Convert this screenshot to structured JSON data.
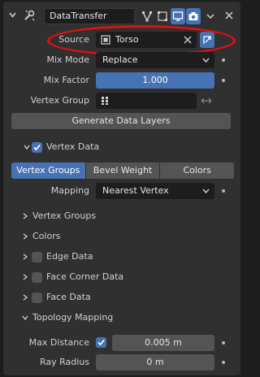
{
  "header": {
    "modifier_name": "DataTransfer",
    "icons": [
      "collapse-arrow-icon",
      "wrench-icon",
      "vertex-edit-icon",
      "edit-mode-icon",
      "realtime-icon",
      "render-icon",
      "dropdown-chevron-icon",
      "close-icon"
    ]
  },
  "source": {
    "label": "Source",
    "value": "Torso"
  },
  "mix_mode": {
    "label": "Mix Mode",
    "value": "Replace"
  },
  "mix_factor": {
    "label": "Mix Factor",
    "value": "1.000"
  },
  "vertex_group": {
    "label": "Vertex Group",
    "value": ""
  },
  "generate_button": "Generate Data Layers",
  "vertex_data": {
    "label": "Vertex Data",
    "checked": true,
    "tabs": [
      "Vertex Groups",
      "Bevel Weight",
      "Colors"
    ],
    "active_tab": "Vertex Groups",
    "mapping_label": "Mapping",
    "mapping_value": "Nearest Vertex"
  },
  "subpanels": {
    "vertex_groups": "Vertex Groups",
    "colors": "Colors"
  },
  "edge_data": {
    "label": "Edge Data",
    "checked": false
  },
  "face_corner_data": {
    "label": "Face Corner Data",
    "checked": false
  },
  "face_data": {
    "label": "Face Data",
    "checked": false
  },
  "topology_mapping": {
    "label": "Topology Mapping",
    "max_distance_label": "Max Distance",
    "max_distance_checked": true,
    "max_distance_value": "0.005 m",
    "ray_radius_label": "Ray Radius",
    "ray_radius_value": "0 m"
  },
  "colors": {
    "accent": "#4772b3",
    "panel": "#303030",
    "field": "#1d1d1d",
    "button": "#545454",
    "highlight": "#e01010"
  }
}
